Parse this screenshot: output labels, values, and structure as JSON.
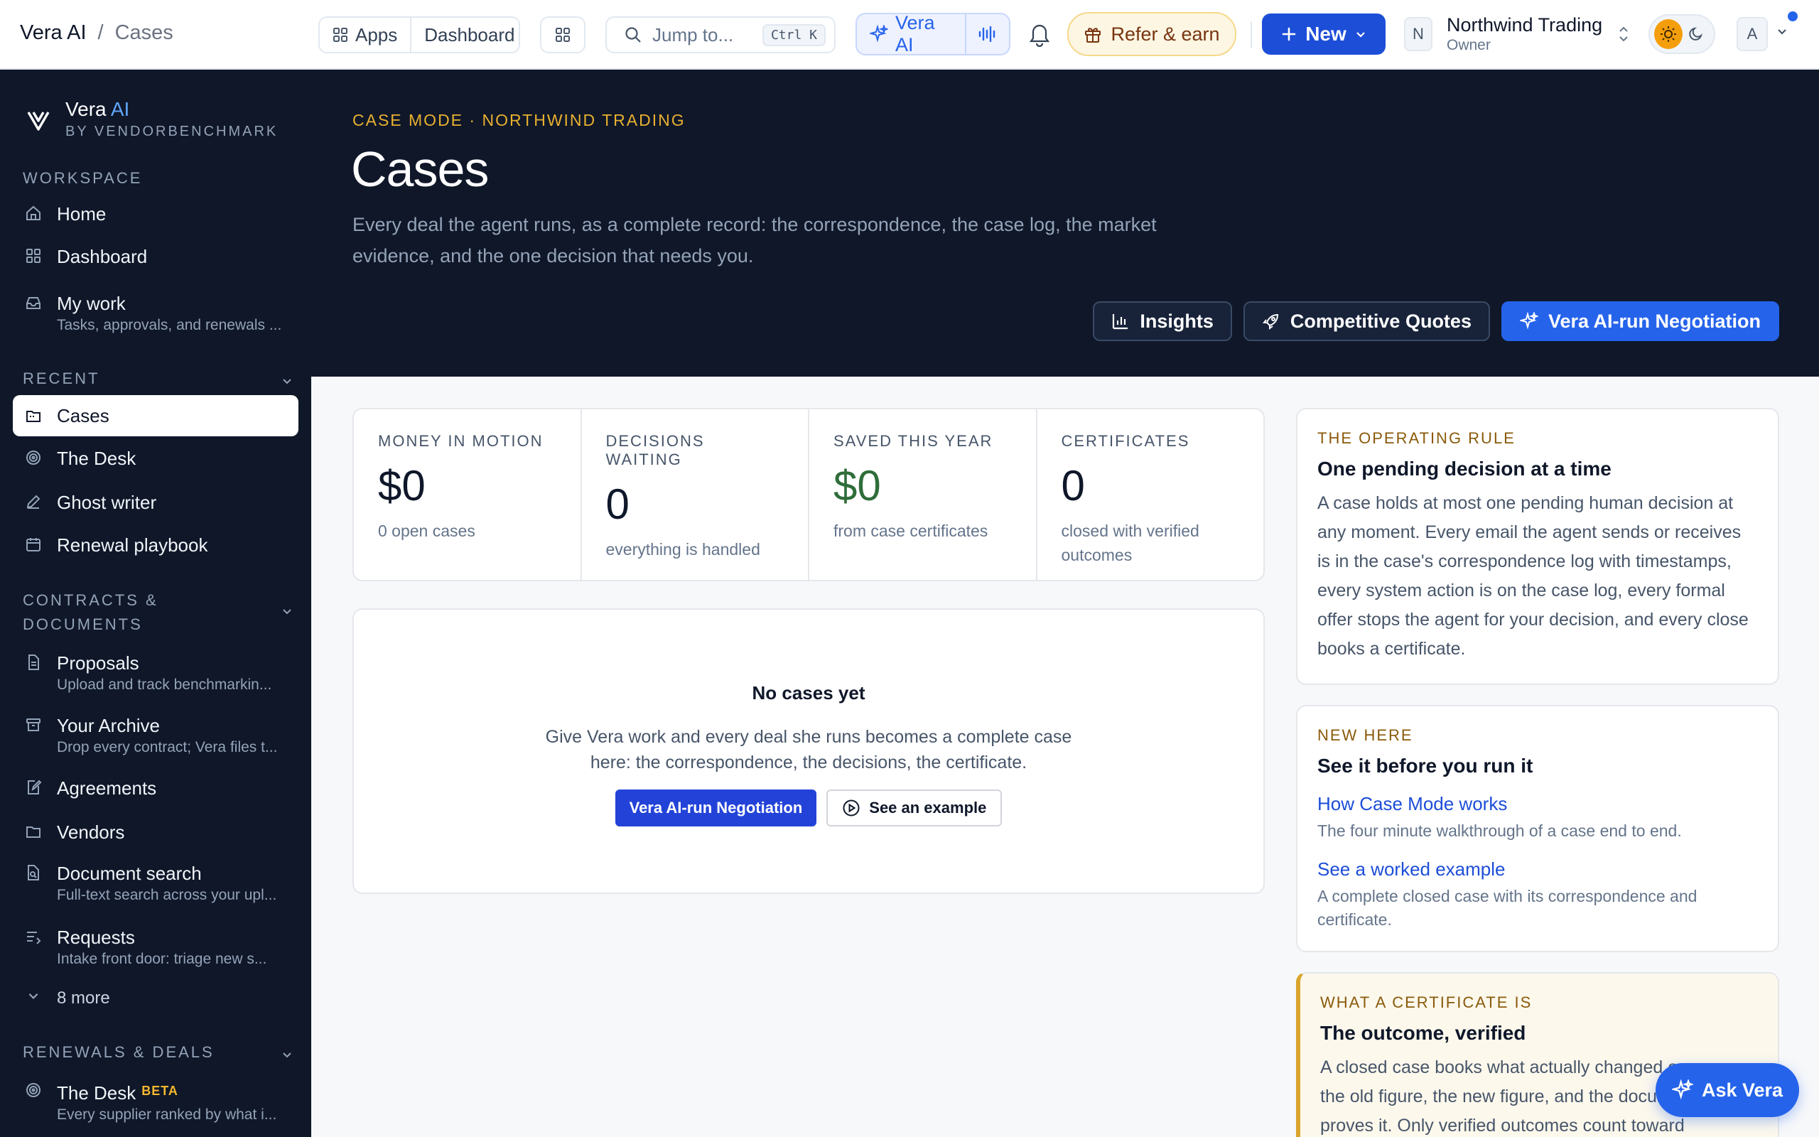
{
  "breadcrumb": {
    "root": "Vera AI",
    "separator": "/",
    "current": "Cases"
  },
  "topbar": {
    "apps_label": "Apps",
    "dashboard_label": "Dashboard",
    "search_placeholder": "Jump to...",
    "search_shortcut": "Ctrl K",
    "vera_label": "Vera AI",
    "refer_label": "Refer & earn",
    "new_label": "New",
    "org_initial": "N",
    "org_name": "Northwind Trading",
    "org_role": "Owner",
    "user_initial": "A"
  },
  "brand": {
    "name": "Vera",
    "name_accent": "AI",
    "sub": "BY VENDORBENCHMARK"
  },
  "sidebar": {
    "workspace_label": "WORKSPACE",
    "workspace": [
      {
        "label": "Home",
        "icon": "home-icon"
      },
      {
        "label": "Dashboard",
        "icon": "dashboard-icon"
      },
      {
        "label": "My work",
        "sub": "Tasks, approvals, and renewals ...",
        "icon": "inbox-icon"
      }
    ],
    "recent_label": "RECENT",
    "recent": [
      {
        "label": "Cases",
        "icon": "folder-icon"
      },
      {
        "label": "The Desk",
        "icon": "target-icon"
      },
      {
        "label": "Ghost writer",
        "icon": "pen-icon"
      },
      {
        "label": "Renewal playbook",
        "icon": "calendar-icon"
      }
    ],
    "contracts_label_1": "CONTRACTS &",
    "contracts_label_2": "DOCUMENTS",
    "contracts": [
      {
        "label": "Proposals",
        "sub": "Upload and track benchmarkin...",
        "icon": "document-icon"
      },
      {
        "label": "Your Archive",
        "sub": "Drop every contract; Vera files t...",
        "icon": "archive-icon"
      },
      {
        "label": "Agreements",
        "icon": "edit-document-icon"
      },
      {
        "label": "Vendors",
        "icon": "folder-icon"
      },
      {
        "label": "Document search",
        "sub": "Full-text search across your upl...",
        "icon": "search-document-icon"
      },
      {
        "label": "Requests",
        "sub": "Intake front door: triage new s...",
        "icon": "list-icon"
      }
    ],
    "more_label": "8 more",
    "renewals_label": "RENEWALS & DEALS",
    "renewals": [
      {
        "label": "The Desk",
        "badge": "BETA",
        "sub": "Every supplier ranked by what i...",
        "icon": "target-icon"
      }
    ]
  },
  "hero": {
    "eyebrow": "CASE MODE · NORTHWIND TRADING",
    "title": "Cases",
    "description": "Every deal the agent runs, as a complete record: the correspondence, the case log, the market evidence, and the one decision that needs you.",
    "buttons": {
      "insights": "Insights",
      "quotes": "Competitive Quotes",
      "negotiation": "Vera AI-run Negotiation"
    }
  },
  "stats": [
    {
      "label": "MONEY IN MOTION",
      "value": "$0",
      "desc": "0 open cases"
    },
    {
      "label": "DECISIONS WAITING",
      "value": "0",
      "desc": "everything is handled"
    },
    {
      "label": "SAVED THIS YEAR",
      "value": "$0",
      "desc": "from case certificates"
    },
    {
      "label": "CERTIFICATES",
      "value": "0",
      "desc": "closed with verified outcomes"
    }
  ],
  "empty": {
    "title": "No cases yet",
    "text": "Give Vera work and every deal she runs becomes a complete case here: the correspondence, the decisions, the certificate.",
    "primary": "Vera AI-run Negotiation",
    "secondary": "See an example"
  },
  "cards": {
    "rule": {
      "eyebrow": "THE OPERATING RULE",
      "title": "One pending decision at a time",
      "text": "A case holds at most one pending human decision at any moment. Every email the agent sends or receives is in the case's correspondence log with timestamps, every system action is on the case log, every formal offer stops the agent for your decision, and every close books a certificate."
    },
    "new_here": {
      "eyebrow": "NEW HERE",
      "title": "See it before you run it",
      "link1": "How Case Mode works",
      "link1_desc": "The four minute walkthrough of a case end to end.",
      "link2": "See a worked example",
      "link2_desc": "A complete closed case with its correspondence and certificate."
    },
    "cert": {
      "eyebrow": "WHAT A CERTIFICATE IS",
      "title": "The outcome, verified",
      "text": "A closed case books what actually changed on paper: the old figure, the new figure, and the document that proves it. Only verified outcomes count toward"
    }
  },
  "ask_label": "Ask Vera",
  "colors": {
    "navy": "#0f1729",
    "accent": "#2563eb",
    "gold": "#e8b030",
    "green": "#2f6d3a"
  }
}
